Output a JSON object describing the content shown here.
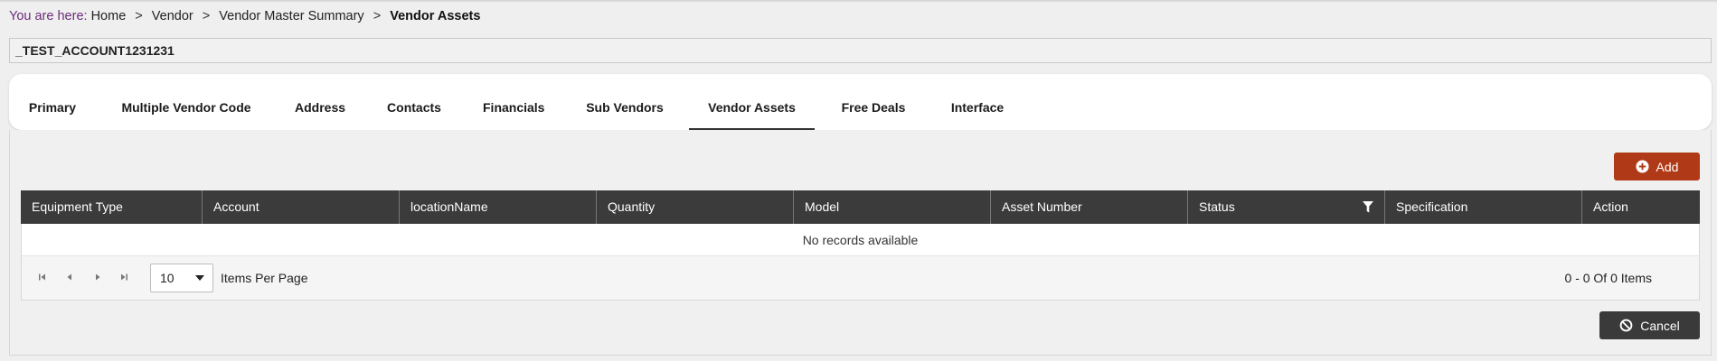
{
  "breadcrumb": {
    "lead": "You are here:",
    "items": [
      "Home",
      "Vendor",
      "Vendor Master Summary"
    ],
    "current": "Vendor Assets",
    "separator": ">"
  },
  "account": {
    "name": "_TEST_ACCOUNT1231231"
  },
  "tabs": [
    {
      "label": "Primary"
    },
    {
      "label": "Multiple Vendor Code"
    },
    {
      "label": "Address"
    },
    {
      "label": "Contacts"
    },
    {
      "label": "Financials"
    },
    {
      "label": "Sub Vendors"
    },
    {
      "label": "Vendor Assets",
      "active": true
    },
    {
      "label": "Free Deals"
    },
    {
      "label": "Interface"
    }
  ],
  "toolbar": {
    "add_label": "Add"
  },
  "grid": {
    "columns": [
      "Equipment Type",
      "Account",
      "locationName",
      "Quantity",
      "Model",
      "Asset Number",
      "Status",
      "Specification",
      "Action"
    ],
    "empty_message": "No records available"
  },
  "pager": {
    "page_size": "10",
    "items_per_page_label": "Items Per Page",
    "info": "0 - 0 Of 0 Items"
  },
  "footer": {
    "cancel_label": "Cancel"
  },
  "colors": {
    "accent_add": "#b03a17",
    "header_dark": "#3b3b3b",
    "breadcrumb_lead": "#6b2c7a"
  }
}
